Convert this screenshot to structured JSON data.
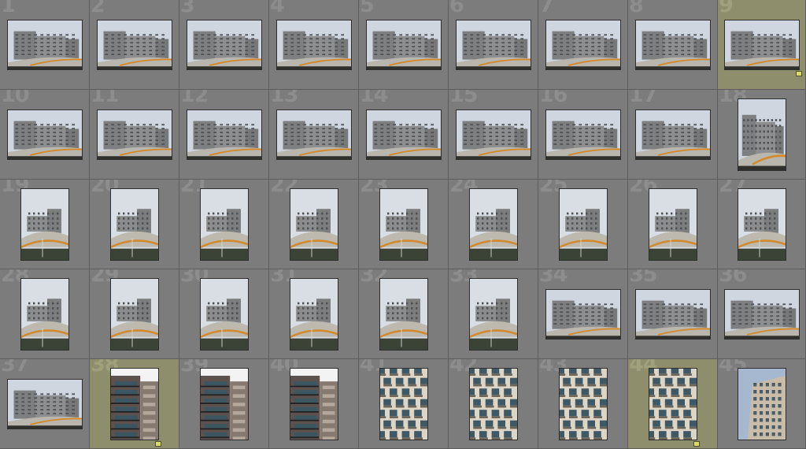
{
  "colors": {
    "cell_background": "#7c7c7c",
    "selected_cell_background": "#8e8e6c",
    "cell_border": "#5c5c5c",
    "index_number": "#8d8d8d",
    "flag_badge": "#d9dc6a"
  },
  "grid": {
    "columns": 9,
    "cells": [
      {
        "index": "1",
        "scene": "building-wide",
        "orientation": "landscape",
        "selected": false,
        "flagged": false
      },
      {
        "index": "2",
        "scene": "building-wide",
        "orientation": "landscape",
        "selected": false,
        "flagged": false
      },
      {
        "index": "3",
        "scene": "building-wide",
        "orientation": "landscape",
        "selected": false,
        "flagged": false
      },
      {
        "index": "4",
        "scene": "building-wide",
        "orientation": "landscape",
        "selected": false,
        "flagged": false
      },
      {
        "index": "5",
        "scene": "building-wide",
        "orientation": "landscape",
        "selected": false,
        "flagged": false
      },
      {
        "index": "6",
        "scene": "building-wide",
        "orientation": "landscape",
        "selected": false,
        "flagged": false
      },
      {
        "index": "7",
        "scene": "building-wide",
        "orientation": "landscape",
        "selected": false,
        "flagged": false
      },
      {
        "index": "8",
        "scene": "building-wide",
        "orientation": "landscape",
        "selected": false,
        "flagged": false
      },
      {
        "index": "9",
        "scene": "building-wide",
        "orientation": "landscape",
        "selected": true,
        "flagged": true
      },
      {
        "index": "10",
        "scene": "building-wide",
        "orientation": "landscape",
        "selected": false,
        "flagged": false
      },
      {
        "index": "11",
        "scene": "building-wide",
        "orientation": "landscape",
        "selected": false,
        "flagged": false
      },
      {
        "index": "12",
        "scene": "building-wide",
        "orientation": "landscape",
        "selected": false,
        "flagged": false
      },
      {
        "index": "13",
        "scene": "building-wide",
        "orientation": "landscape",
        "selected": false,
        "flagged": false
      },
      {
        "index": "14",
        "scene": "building-wide",
        "orientation": "landscape",
        "selected": false,
        "flagged": false
      },
      {
        "index": "15",
        "scene": "building-wide",
        "orientation": "landscape",
        "selected": false,
        "flagged": false
      },
      {
        "index": "16",
        "scene": "building-wide",
        "orientation": "landscape",
        "selected": false,
        "flagged": false
      },
      {
        "index": "17",
        "scene": "building-wide",
        "orientation": "landscape",
        "selected": false,
        "flagged": false
      },
      {
        "index": "18",
        "scene": "building-portrait",
        "orientation": "portrait-wide",
        "selected": false,
        "flagged": false
      },
      {
        "index": "19",
        "scene": "roof-portrait",
        "orientation": "portrait",
        "selected": false,
        "flagged": false
      },
      {
        "index": "20",
        "scene": "roof-portrait",
        "orientation": "portrait",
        "selected": false,
        "flagged": false
      },
      {
        "index": "21",
        "scene": "roof-portrait",
        "orientation": "portrait",
        "selected": false,
        "flagged": false
      },
      {
        "index": "22",
        "scene": "roof-portrait",
        "orientation": "portrait",
        "selected": false,
        "flagged": false
      },
      {
        "index": "23",
        "scene": "roof-portrait",
        "orientation": "portrait",
        "selected": false,
        "flagged": false
      },
      {
        "index": "24",
        "scene": "roof-portrait",
        "orientation": "portrait",
        "selected": false,
        "flagged": false
      },
      {
        "index": "25",
        "scene": "roof-portrait",
        "orientation": "portrait",
        "selected": false,
        "flagged": false
      },
      {
        "index": "26",
        "scene": "roof-portrait",
        "orientation": "portrait",
        "selected": false,
        "flagged": false
      },
      {
        "index": "27",
        "scene": "roof-portrait",
        "orientation": "portrait",
        "selected": false,
        "flagged": false
      },
      {
        "index": "28",
        "scene": "roof-portrait",
        "orientation": "portrait",
        "selected": false,
        "flagged": false
      },
      {
        "index": "29",
        "scene": "roof-portrait",
        "orientation": "portrait",
        "selected": false,
        "flagged": false
      },
      {
        "index": "30",
        "scene": "roof-portrait",
        "orientation": "portrait",
        "selected": false,
        "flagged": false
      },
      {
        "index": "31",
        "scene": "roof-portrait",
        "orientation": "portrait",
        "selected": false,
        "flagged": false
      },
      {
        "index": "32",
        "scene": "roof-portrait",
        "orientation": "portrait",
        "selected": false,
        "flagged": false
      },
      {
        "index": "33",
        "scene": "roof-portrait",
        "orientation": "portrait",
        "selected": false,
        "flagged": false
      },
      {
        "index": "34",
        "scene": "building-wide",
        "orientation": "landscape",
        "selected": false,
        "flagged": false
      },
      {
        "index": "35",
        "scene": "building-wide",
        "orientation": "landscape",
        "selected": false,
        "flagged": false
      },
      {
        "index": "36",
        "scene": "building-wide",
        "orientation": "landscape",
        "selected": false,
        "flagged": false
      },
      {
        "index": "37",
        "scene": "building-wide",
        "orientation": "landscape",
        "selected": false,
        "flagged": false
      },
      {
        "index": "38",
        "scene": "facade-brick",
        "orientation": "portrait",
        "selected": true,
        "flagged": true
      },
      {
        "index": "39",
        "scene": "facade-brick",
        "orientation": "portrait",
        "selected": false,
        "flagged": false
      },
      {
        "index": "40",
        "scene": "facade-brick",
        "orientation": "portrait",
        "selected": false,
        "flagged": false
      },
      {
        "index": "41",
        "scene": "facade-balconies",
        "orientation": "portrait",
        "selected": false,
        "flagged": false
      },
      {
        "index": "42",
        "scene": "facade-balconies",
        "orientation": "portrait",
        "selected": false,
        "flagged": false
      },
      {
        "index": "43",
        "scene": "facade-balconies",
        "orientation": "portrait",
        "selected": false,
        "flagged": false
      },
      {
        "index": "44",
        "scene": "facade-balconies",
        "orientation": "portrait",
        "selected": true,
        "flagged": true
      },
      {
        "index": "45",
        "scene": "facade-sky",
        "orientation": "portrait",
        "selected": false,
        "flagged": false
      }
    ]
  }
}
